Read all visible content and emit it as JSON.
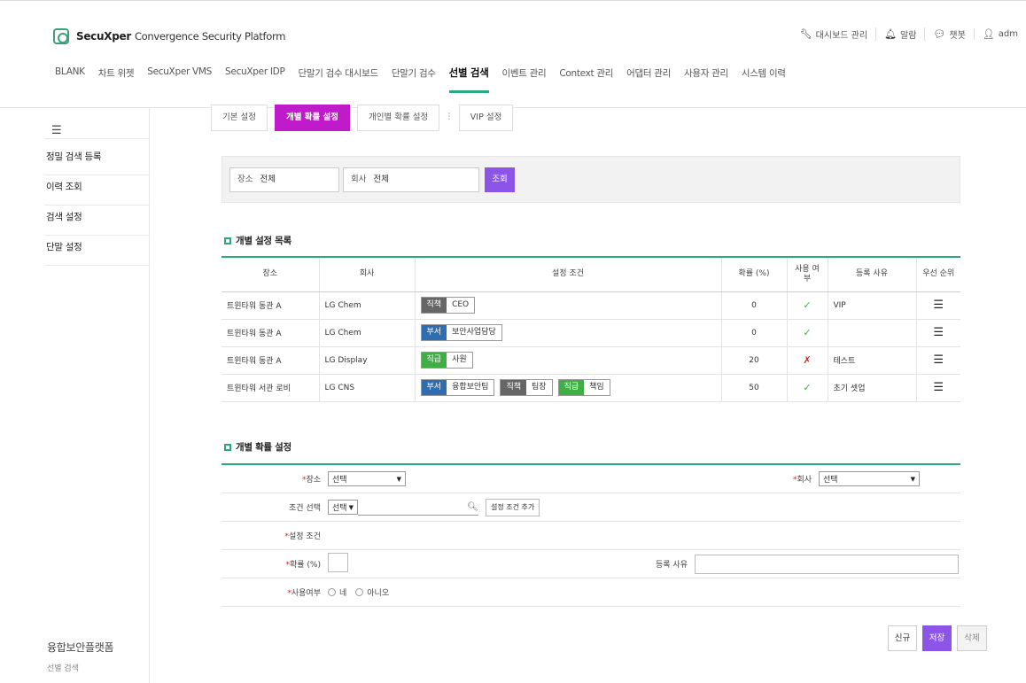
{
  "brand": {
    "name": "SecuXper",
    "subtitle": "Convergence Security Platform"
  },
  "top_util": [
    {
      "icon": "wrench-icon",
      "label": "대시보드 관리"
    },
    {
      "icon": "bell-icon",
      "label": "알람"
    },
    {
      "icon": "chat-icon",
      "label": "챗봇"
    },
    {
      "icon": "user-icon",
      "label": "adm"
    }
  ],
  "gnb": [
    "BLANK",
    "차트 위젯",
    "SecuXper VMS",
    "SecuXper IDP",
    "단말기 검수 대시보드",
    "단말기 검수",
    "선별 검색",
    "이벤트 관리",
    "Context 관리",
    "어댑터 관리",
    "사용자 관리",
    "시스템 이력"
  ],
  "gnb_active": 6,
  "sidebar": {
    "menu_icon": "☰",
    "items": [
      "정밀 검색 등록",
      "이력 조회",
      "검색 설정",
      "단말 설정"
    ],
    "footer_title": "융합보안플랫폼",
    "footer_sub": "선별 검색"
  },
  "tabs": [
    "기본 설정",
    "개별 확률 설정",
    "개인별 확률 설정",
    "VIP 설정"
  ],
  "tabs_active": 1,
  "filter": {
    "place_label": "장소",
    "place_value": "전체",
    "company_label": "회사",
    "company_value": "전체",
    "search_btn": "조회"
  },
  "list_title": "개별 설정 목록",
  "table": {
    "headers": [
      "장소",
      "회사",
      "설정 조건",
      "확률 (%)",
      "사용 여부",
      "등록 사유",
      "우선 순위"
    ],
    "rows": [
      {
        "place": "트윈타워 동관 A",
        "company": "LG Chem",
        "conds": [
          {
            "k": "직책",
            "v": "CEO",
            "c": "gray"
          }
        ],
        "prob": "0",
        "use": true,
        "reason": "VIP"
      },
      {
        "place": "트윈타워 동관 A",
        "company": "LG Chem",
        "conds": [
          {
            "k": "부서",
            "v": "보안사업담당",
            "c": "blue"
          }
        ],
        "prob": "0",
        "use": true,
        "reason": ""
      },
      {
        "place": "트윈타워 동관 A",
        "company": "LG Display",
        "conds": [
          {
            "k": "직급",
            "v": "사원",
            "c": "green"
          }
        ],
        "prob": "20",
        "use": false,
        "reason": "테스트"
      },
      {
        "place": "트윈타워 서관 로비",
        "company": "LG CNS",
        "conds": [
          {
            "k": "부서",
            "v": "융합보안팀",
            "c": "blue"
          },
          {
            "k": "직책",
            "v": "팀장",
            "c": "gray"
          },
          {
            "k": "직급",
            "v": "책임",
            "c": "green"
          }
        ],
        "prob": "50",
        "use": true,
        "reason": "초기 셋업"
      }
    ]
  },
  "form_title": "개별 확률 설정",
  "form": {
    "place_label": "장소",
    "place_select": "선택",
    "company_label": "회사",
    "company_select": "선택",
    "cond_label": "조건 선택",
    "cond_select": "선택",
    "cond_add": "설정 조건 추가",
    "setcond_label": "설정 조건",
    "prob_label": "확률 (%)",
    "reason_label": "등록 사유",
    "use_label": "사용여부",
    "yes": "네",
    "no": "아니오"
  },
  "buttons": {
    "new": "신규",
    "save": "저장",
    "delete": "삭제"
  }
}
